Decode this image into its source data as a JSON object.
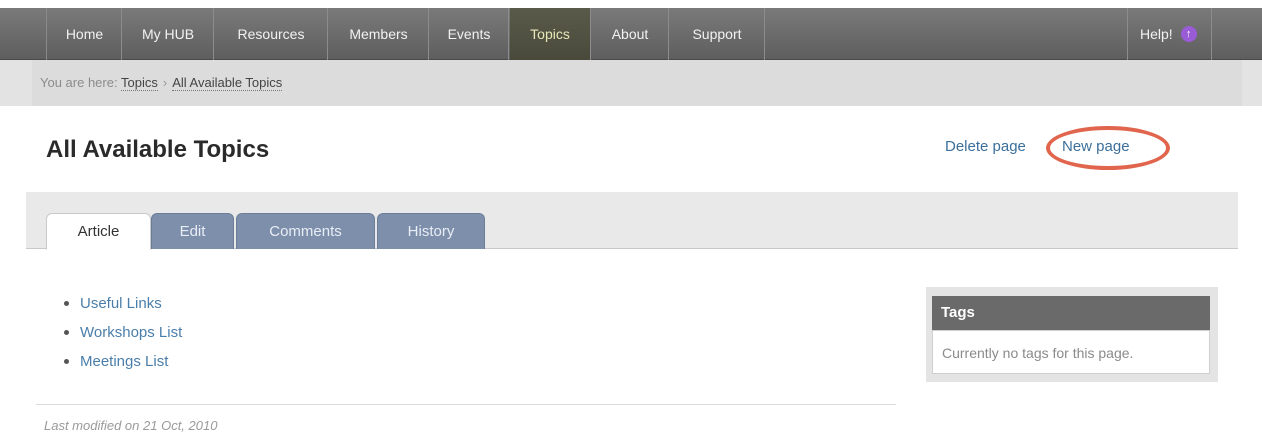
{
  "nav": {
    "items": [
      {
        "label": "Home"
      },
      {
        "label": "My HUB"
      },
      {
        "label": "Resources"
      },
      {
        "label": "Members"
      },
      {
        "label": "Events"
      },
      {
        "label": "Topics",
        "active": true
      },
      {
        "label": "About"
      },
      {
        "label": "Support"
      }
    ],
    "help_label": "Help!",
    "help_icon": "info-circle-icon"
  },
  "breadcrumb": {
    "prefix": "You are here:",
    "items": [
      "Topics",
      "All Available Topics"
    ],
    "separator": "›"
  },
  "page": {
    "title": "All Available Topics",
    "delete_label": "Delete page",
    "new_label": "New page"
  },
  "tabs": [
    {
      "label": "Article",
      "active": true
    },
    {
      "label": "Edit"
    },
    {
      "label": "Comments"
    },
    {
      "label": "History"
    }
  ],
  "links": [
    "Useful Links",
    "Workshops List",
    "Meetings List"
  ],
  "tags": {
    "heading": "Tags",
    "empty_text": "Currently no tags for this page."
  },
  "footer": {
    "modified": "Last modified on 21 Oct, 2010"
  },
  "colors": {
    "nav_bg": "#666666",
    "link": "#4a7eaa",
    "tab_inactive": "#7d8fab",
    "highlight_ring": "#e0654c"
  }
}
